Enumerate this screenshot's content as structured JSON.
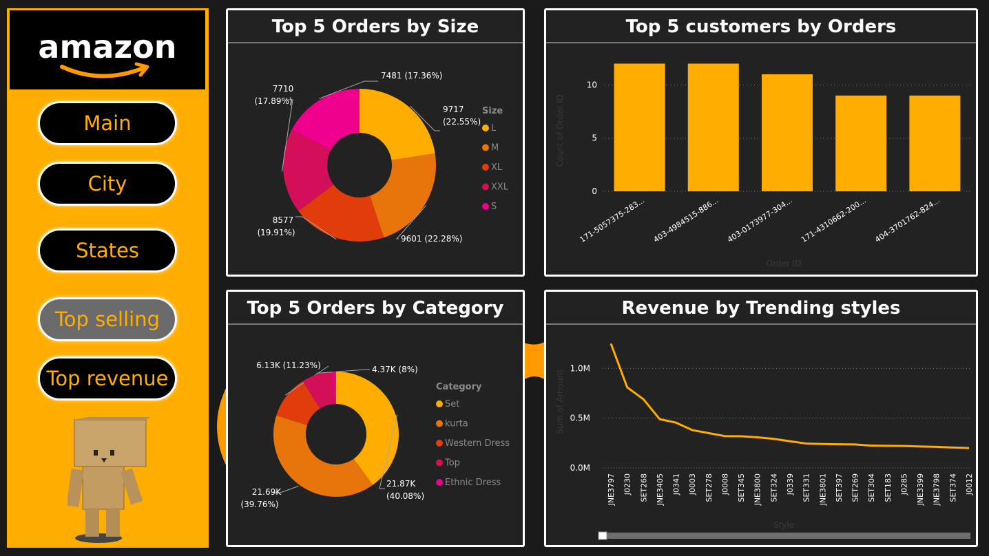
{
  "brand": {
    "name": "amazon"
  },
  "nav": {
    "items": [
      {
        "label": "Main"
      },
      {
        "label": "City"
      },
      {
        "label": "States"
      },
      {
        "label": "Top selling",
        "active": true
      },
      {
        "label": "Top revenue"
      }
    ]
  },
  "colors": {
    "accent": "#ffad00",
    "background": "#1a1a1a",
    "panel": "#222222"
  },
  "panels": {
    "size": {
      "title": "Top 5 Orders by Size"
    },
    "customers": {
      "title": "Top 5 customers by Orders"
    },
    "category": {
      "title": "Top 5 Orders by Category"
    },
    "revenue": {
      "title": "Revenue by Trending styles"
    }
  },
  "chart_data": [
    {
      "id": "size",
      "type": "pie",
      "legend_title": "Size",
      "legend_position": "right",
      "slices": [
        {
          "name": "L",
          "value": 9717,
          "label": "9717",
          "pct": "(22.55%)",
          "color": "#ffad00"
        },
        {
          "name": "M",
          "value": 9601,
          "label": "9601 (22.28%)",
          "color": "#e8740c"
        },
        {
          "name": "XL",
          "value": 8577,
          "label": "8577",
          "pct": "(19.91%)",
          "color": "#e03c0c"
        },
        {
          "name": "XXL",
          "value": 7710,
          "label": "7710",
          "pct": "(17.89%)",
          "color": "#d40f5a"
        },
        {
          "name": "S",
          "value": 7481,
          "label": "7481 (17.36%)",
          "color": "#ee008c"
        }
      ]
    },
    {
      "id": "customers",
      "type": "bar",
      "categories": [
        "171-5057375-283...",
        "403-4984515-886...",
        "403-0173977-304...",
        "171-4310662-200...",
        "404-3701762-824..."
      ],
      "values": [
        12,
        12,
        11,
        9,
        9
      ],
      "ylabel": "Count of Order ID",
      "xlabel": "Order ID",
      "yticks": [
        0,
        5,
        10
      ],
      "ylim": [
        0,
        13
      ],
      "grid": true,
      "color": "#ffad00"
    },
    {
      "id": "category",
      "type": "pie",
      "legend_title": "Category",
      "legend_position": "right",
      "slices": [
        {
          "name": "Set",
          "value": 21870,
          "label": "21.87K",
          "pct": "(40.08%)",
          "color": "#ffad00"
        },
        {
          "name": "kurta",
          "value": 21690,
          "label": "21.69K",
          "pct": "(39.76%)",
          "color": "#e8740c"
        },
        {
          "name": "Western Dress",
          "value": 6130,
          "label": "6.13K (11.23%)",
          "color": "#e03c0c"
        },
        {
          "name": "Top",
          "value": 4370,
          "label": "4.37K (8%)",
          "color": "#d40f5a"
        },
        {
          "name": "Ethnic Dress",
          "value": 500,
          "label": "",
          "color": "#ee008c"
        }
      ]
    },
    {
      "id": "revenue",
      "type": "line",
      "x": [
        "JNE3797",
        "J0230",
        "SET268",
        "JNE3405",
        "J0341",
        "J0003",
        "SET278",
        "J0008",
        "SET345",
        "JNE3800",
        "SET324",
        "J0339",
        "SET331",
        "JNE3801",
        "SET397",
        "SET269",
        "SET304",
        "SET183",
        "J0285",
        "JNE3399",
        "JNE3798",
        "SET374",
        "J0012"
      ],
      "values": [
        1250000,
        810000,
        690000,
        490000,
        455000,
        380000,
        350000,
        320000,
        318000,
        308000,
        292000,
        268000,
        245000,
        240000,
        238000,
        236000,
        224000,
        222000,
        220000,
        215000,
        212000,
        205000,
        200000
      ],
      "ylabel": "Sum of Amount",
      "xlabel": "Style",
      "yticks": [
        {
          "v": 0,
          "label": "0.0M"
        },
        {
          "v": 500000,
          "label": "0.5M"
        },
        {
          "v": 1000000,
          "label": "1.0M"
        }
      ],
      "ylim": [
        0,
        1300000
      ],
      "grid": true,
      "color": "#ffad00"
    }
  ]
}
